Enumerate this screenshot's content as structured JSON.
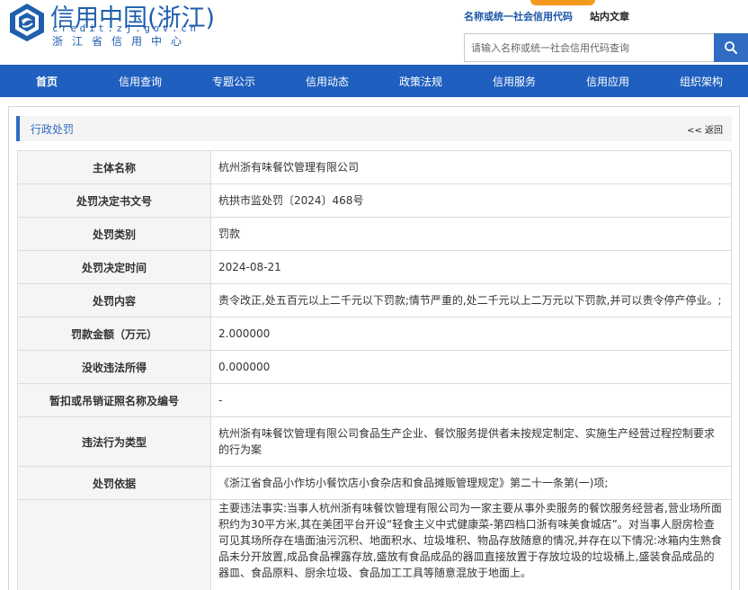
{
  "header": {
    "logo_title": "信用中国(浙江)",
    "logo_url": "credit.zj.gov.cn",
    "logo_sub": "浙江省信用中心",
    "top_links": [
      "名称或统一社会信用代码",
      "站内文章"
    ],
    "search_placeholder": "请输入名称或统一社会信用代码查询",
    "brand_color": "#1f5fbf",
    "accent_color": "#f39a1e"
  },
  "nav": [
    "首页",
    "信用查询",
    "专题公示",
    "信用动态",
    "政策法规",
    "信用服务",
    "信用应用",
    "组织架构"
  ],
  "panel": {
    "title": "行政处罚",
    "back_label": "<< 返回"
  },
  "rows": [
    {
      "label": "主体名称",
      "value": "杭州浙有味餐饮管理有限公司"
    },
    {
      "label": "处罚决定书文号",
      "value": "杭拱市监处罚〔2024〕468号"
    },
    {
      "label": "处罚类别",
      "value": "罚款"
    },
    {
      "label": "处罚决定时间",
      "value": "2024-08-21"
    },
    {
      "label": "处罚内容",
      "value": "责令改正,处五百元以上二千元以下罚款;情节严重的,处二千元以上二万元以下罚款,并可以责令停产停业。;"
    },
    {
      "label": "罚款金额（万元）",
      "value": "2.000000"
    },
    {
      "label": "没收违法所得",
      "value": "0.000000"
    },
    {
      "label": "暂扣或吊销证照名称及编号",
      "value": "-"
    },
    {
      "label": "违法行为类型",
      "value": "杭州浙有味餐饮管理有限公司食品生产企业、餐饮服务提供者未按规定制定、实施生产经营过程控制要求的行为案"
    },
    {
      "label": "处罚依据",
      "value": "《浙江省食品小作坊小餐饮店小食杂店和食品摊贩管理规定》第二十一条第(一)项;"
    },
    {
      "label": "",
      "value": "主要违法事实:当事人杭州浙有味餐饮管理有限公司为一家主要从事外卖服务的餐饮服务经营者,营业场所面积约为30平方米,其在美团平台开设“轻食主义中式健康菜-第四档口浙有味美食城店”。对当事人厨房检查可见其场所存在墙面油污沉积、地面积水、垃圾堆积、物品存放随意的情况,并存在以下情况:冰箱内生熟食品未分开放置,成品食品裸露存放,盛放有食品成品的器皿直接放置于存放垃圾的垃圾桶上,盛装食品成品的器皿、食品原料、厨余垃圾、食品加工工具等随意混放于地面上。"
    }
  ]
}
